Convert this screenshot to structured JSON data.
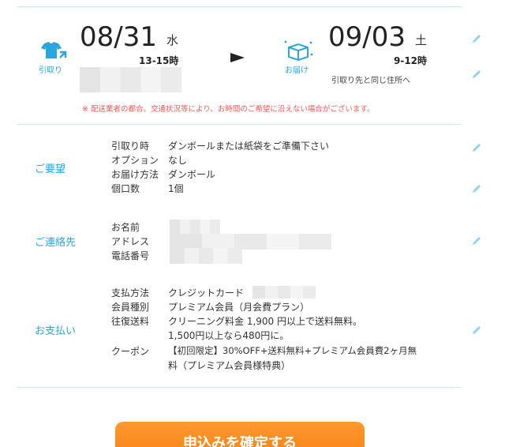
{
  "schedule": {
    "pickup": {
      "label": "引取り",
      "date": "08/31",
      "dow": "水",
      "time": "13-15時"
    },
    "delivery": {
      "label": "お届け",
      "date": "09/03",
      "dow": "土",
      "time": "9-12時",
      "address_note": "引取り先と同じ住所へ"
    },
    "notice": "※ 配送業者の都合、交通状況等により、お時間のご希望に沿えない場合がございます。"
  },
  "request": {
    "title": "ご要望",
    "rows": [
      {
        "label": "引取り時",
        "value": "ダンボールまたは紙袋をご準備下さい"
      },
      {
        "label": "オプション",
        "value": "なし"
      },
      {
        "label": "お届け方法",
        "value": "ダンボール"
      },
      {
        "label": "個口数",
        "value": "1個"
      }
    ]
  },
  "contact": {
    "title": "ご連絡先",
    "rows": [
      {
        "label": "お名前"
      },
      {
        "label": "アドレス"
      },
      {
        "label": "電話番号"
      }
    ]
  },
  "payment": {
    "title": "お支払い",
    "method_label": "支払方法",
    "method_value": "クレジットカード",
    "member_label": "会員種別",
    "member_value": "プレミアム会員（月会費プラン）",
    "shipping_label": "往復送料",
    "shipping_line1": "クリーニング料金 1,900 円以上で送料無料。",
    "shipping_line2": "1,500円以上なら480円に。",
    "coupon_label": "クーポン",
    "coupon_line1": "【初回限定】30%OFF+送料無料+プレミアム会員費2ヶ月無",
    "coupon_line2": "料（プレミアム会員様特典）"
  },
  "cta": {
    "label": "申込みを確定する"
  },
  "colors": {
    "accent": "#2aa6dc",
    "notice": "#e95a5a",
    "cta": "#f57f17",
    "pencil": "#8fd2ec"
  }
}
